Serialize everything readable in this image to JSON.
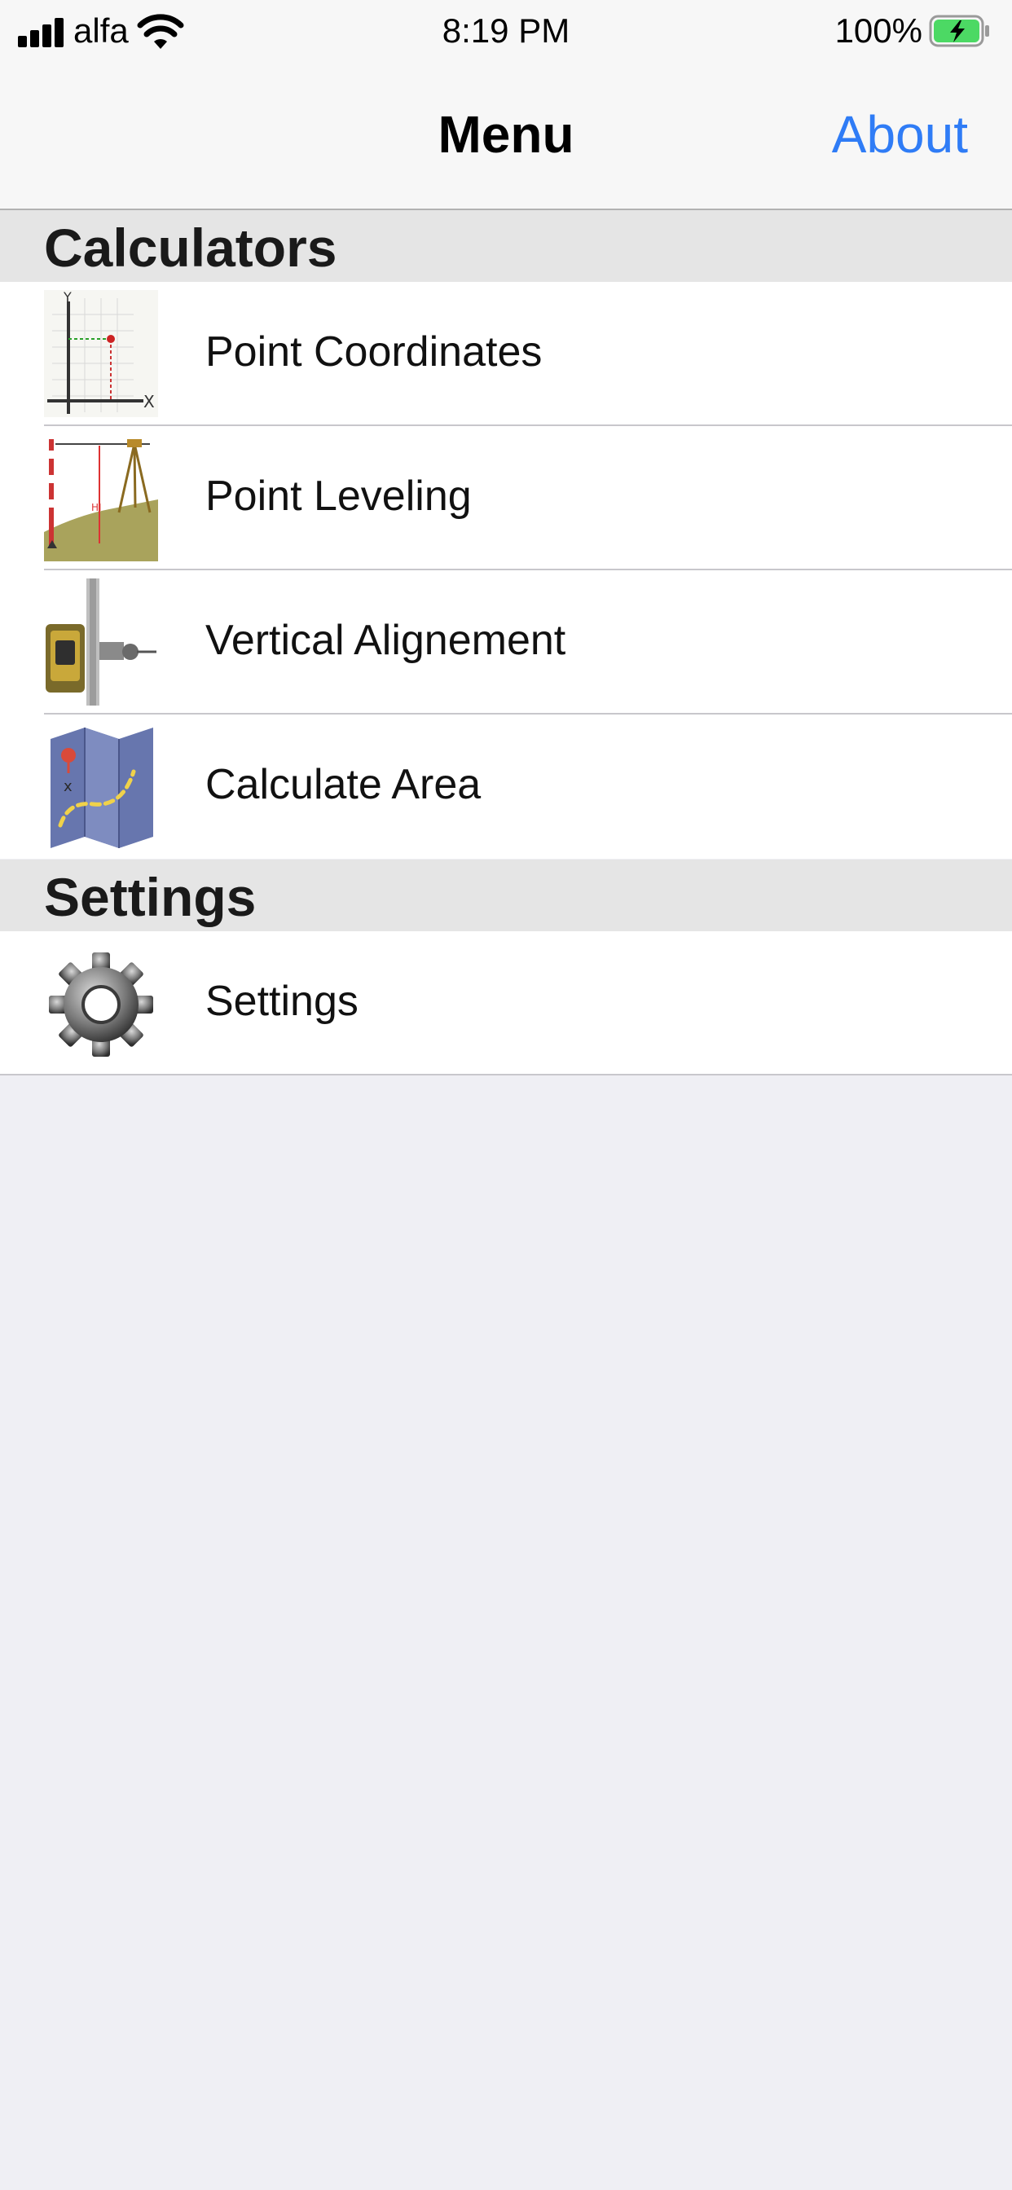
{
  "status_bar": {
    "carrier": "alfa",
    "time": "8:19 PM",
    "battery_percent": "100%"
  },
  "nav": {
    "title": "Menu",
    "about_label": "About"
  },
  "sections": [
    {
      "title": "Calculators",
      "items": [
        {
          "label": "Point Coordinates",
          "icon": "coordinate-axes-icon"
        },
        {
          "label": "Point Leveling",
          "icon": "leveling-survey-icon"
        },
        {
          "label": "Vertical Alignement",
          "icon": "total-station-icon"
        },
        {
          "label": "Calculate Area",
          "icon": "folded-map-icon"
        }
      ]
    },
    {
      "title": "Settings",
      "items": [
        {
          "label": "Settings",
          "icon": "gear-icon"
        }
      ]
    }
  ],
  "colors": {
    "accent": "#2f7cf6",
    "background": "#efeff4",
    "section_header": "#e5e5e5"
  }
}
